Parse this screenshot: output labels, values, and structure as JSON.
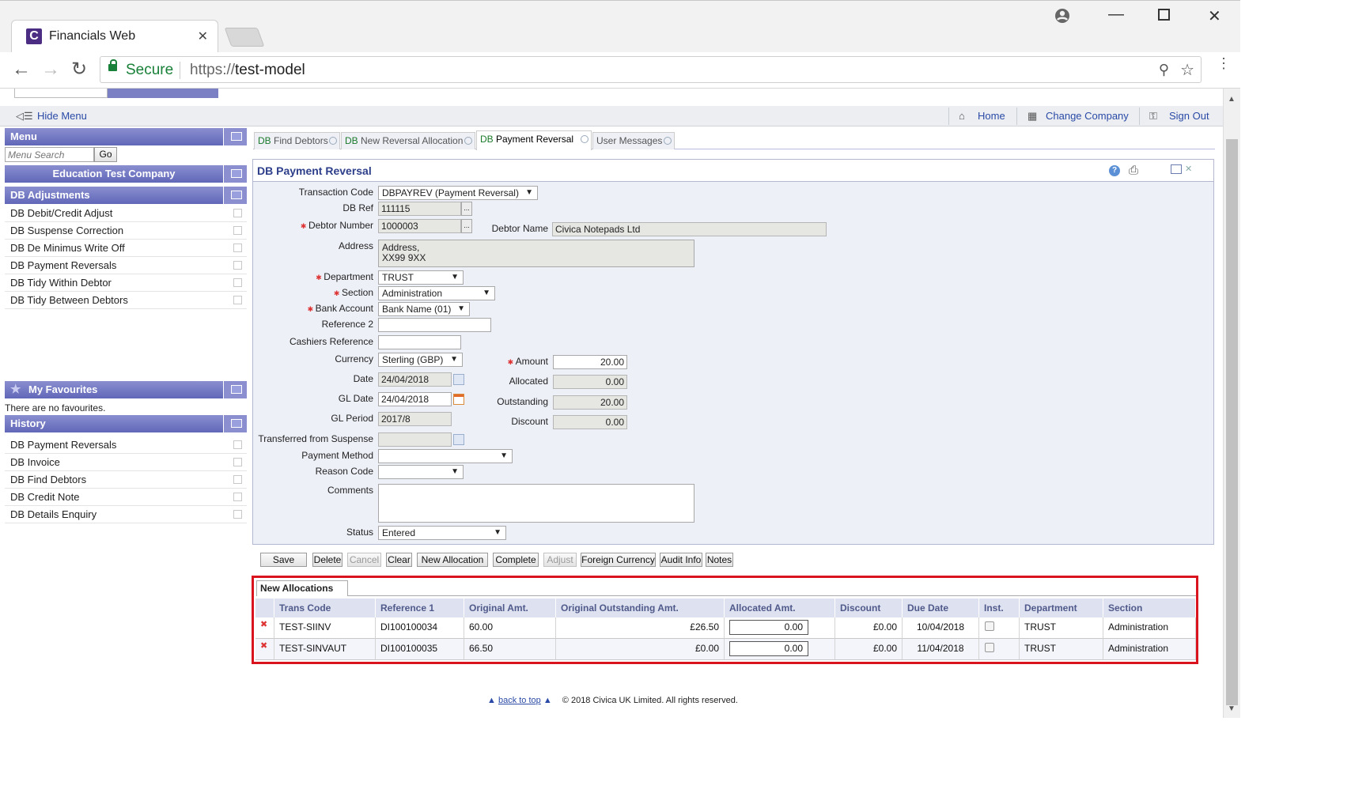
{
  "browser": {
    "tab_title": "Financials Web",
    "tab_logo": "C",
    "secure_label": "Secure",
    "url_scheme": "https://",
    "url_host": "test-model"
  },
  "menubar": {
    "hide_menu": "Hide Menu",
    "home": "Home",
    "change_company": "Change Company",
    "sign_out": "Sign Out"
  },
  "sidebar": {
    "menu_title": "Menu",
    "search_placeholder": "Menu Search",
    "go": "Go",
    "company": "Education Test Company",
    "group_title": "DB Adjustments",
    "items": [
      {
        "label": "DB Debit/Credit Adjust"
      },
      {
        "label": "DB Suspense Correction"
      },
      {
        "label": "DB De Minimus Write Off"
      },
      {
        "label": "DB Payment Reversals"
      },
      {
        "label": "DB Tidy Within Debtor"
      },
      {
        "label": "DB Tidy Between Debtors"
      }
    ],
    "favourites_title": "My Favourites",
    "favourites_empty": "There are no favourites.",
    "history_title": "History",
    "history": [
      {
        "label": "DB Payment Reversals"
      },
      {
        "label": "DB Invoice"
      },
      {
        "label": "DB Find Debtors"
      },
      {
        "label": "DB Credit Note"
      },
      {
        "label": "DB Details Enquiry"
      }
    ]
  },
  "tabs": [
    {
      "prefix": "DB",
      "label": " Find Debtors"
    },
    {
      "prefix": "DB",
      "label": " New Reversal Allocation"
    },
    {
      "prefix": "DB",
      "label": " Payment Reversal"
    },
    {
      "prefix": "",
      "label": "User Messages"
    }
  ],
  "form": {
    "title": "DB Payment Reversal",
    "transaction_code_label": "Transaction Code",
    "transaction_code": "DBPAYREV (Payment Reversal)",
    "db_ref_label": "DB Ref",
    "db_ref": "111115",
    "debtor_number_label": "Debtor Number",
    "debtor_number": "1000003",
    "debtor_name_label": "Debtor Name",
    "debtor_name": "Civica Notepads Ltd",
    "address_label": "Address",
    "address_line1": "Address,",
    "address_line2": "XX99 9XX",
    "department_label": "Department",
    "department": "TRUST",
    "section_label": "Section",
    "section": "Administration",
    "bank_account_label": "Bank Account",
    "bank_account": "Bank Name (01)",
    "reference2_label": "Reference 2",
    "reference2": "",
    "cashiers_reference_label": "Cashiers Reference",
    "cashiers_reference": "",
    "currency_label": "Currency",
    "currency": "Sterling (GBP)",
    "date_label": "Date",
    "date": "24/04/2018",
    "gl_date_label": "GL Date",
    "gl_date": "24/04/2018",
    "gl_period_label": "GL Period",
    "gl_period": "2017/8",
    "transferred_label": "Transferred from Suspense",
    "transferred": "",
    "payment_method_label": "Payment Method",
    "payment_method": "",
    "reason_code_label": "Reason Code",
    "reason_code": "",
    "comments_label": "Comments",
    "comments": "",
    "status_label": "Status",
    "status": "Entered",
    "amount_label": "Amount",
    "amount": "20.00",
    "allocated_label": "Allocated",
    "allocated": "0.00",
    "outstanding_label": "Outstanding",
    "outstanding": "20.00",
    "discount_label": "Discount",
    "discount": "0.00"
  },
  "buttons": {
    "save": "Save",
    "delete": "Delete",
    "cancel": "Cancel",
    "clear": "Clear",
    "new_allocation": "New Allocation",
    "complete": "Complete",
    "adjust": "Adjust",
    "foreign_currency": "Foreign Currency",
    "audit_info": "Audit Info",
    "notes": "Notes"
  },
  "allocations": {
    "tab": "New Allocations",
    "headers": {
      "trans_code": "Trans Code",
      "reference1": "Reference 1",
      "original_amt": "Original Amt.",
      "original_outstanding": "Original Outstanding Amt.",
      "allocated_amt": "Allocated Amt.",
      "discount": "Discount",
      "due_date": "Due Date",
      "inst": "Inst.",
      "department": "Department",
      "section": "Section"
    },
    "rows": [
      {
        "trans_code": "TEST-SIINV",
        "reference1": "DI100100034",
        "original_amt": "60.00",
        "original_outstanding": "£26.50",
        "allocated_amt": "0.00",
        "discount": "£0.00",
        "due_date": "10/04/2018",
        "department": "TRUST",
        "section": "Administration"
      },
      {
        "trans_code": "TEST-SINVAUT",
        "reference1": "DI100100035",
        "original_amt": "66.50",
        "original_outstanding": "£0.00",
        "allocated_amt": "0.00",
        "discount": "£0.00",
        "due_date": "11/04/2018",
        "department": "TRUST",
        "section": "Administration"
      }
    ]
  },
  "footer": {
    "back_to_top": "back to top",
    "copyright": "© 2018 Civica UK Limited. All rights reserved."
  }
}
